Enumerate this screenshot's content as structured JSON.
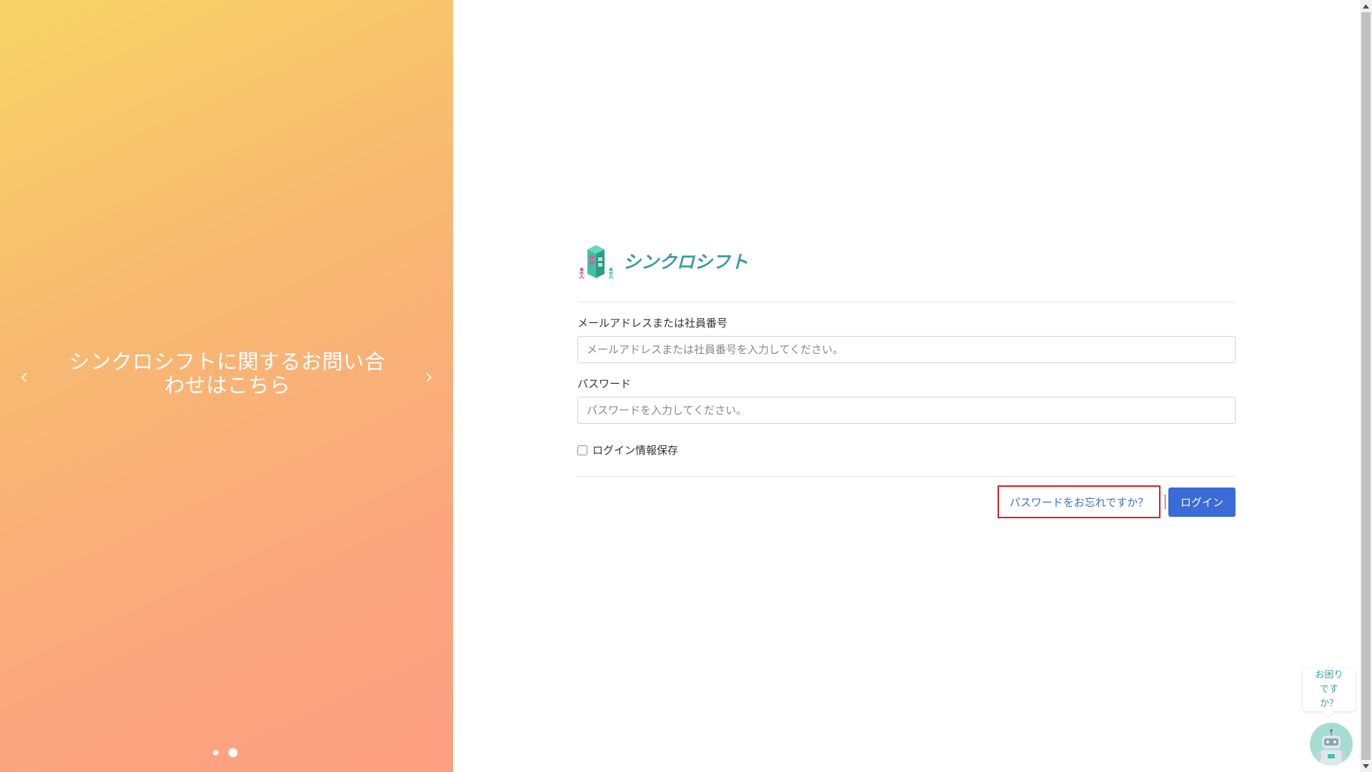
{
  "carousel": {
    "caption_line1": "シンクロシフトに関するお問い合",
    "caption_line2": "わせはこちら",
    "prev_icon": "chevron-left-icon",
    "next_icon": "chevron-right-icon",
    "slide_count": 2,
    "active_slide": 2
  },
  "logo": {
    "text": "シンクロシフト",
    "icon": "building-people-icon",
    "color": "#3a9da5"
  },
  "form": {
    "email_label": "メールアドレスまたは社員番号",
    "email_value": "",
    "email_placeholder": "メールアドレスまたは社員番号を入力してください。",
    "password_label": "パスワード",
    "password_value": "",
    "password_placeholder": "パスワードを入力してください。",
    "remember_label": "ログイン情報保存",
    "remember_checked": false,
    "forgot_label": "パスワードをお忘れですか？",
    "login_label": "ログイン"
  },
  "help": {
    "bubble_text": "お困りですか？",
    "avatar_icon": "robot-icon"
  },
  "colors": {
    "accent": "#3a6bd8",
    "link": "#3c6fd6",
    "highlight_border": "#e01b1b",
    "gradient_start": "#f7d366",
    "gradient_end": "#fd9f82"
  }
}
